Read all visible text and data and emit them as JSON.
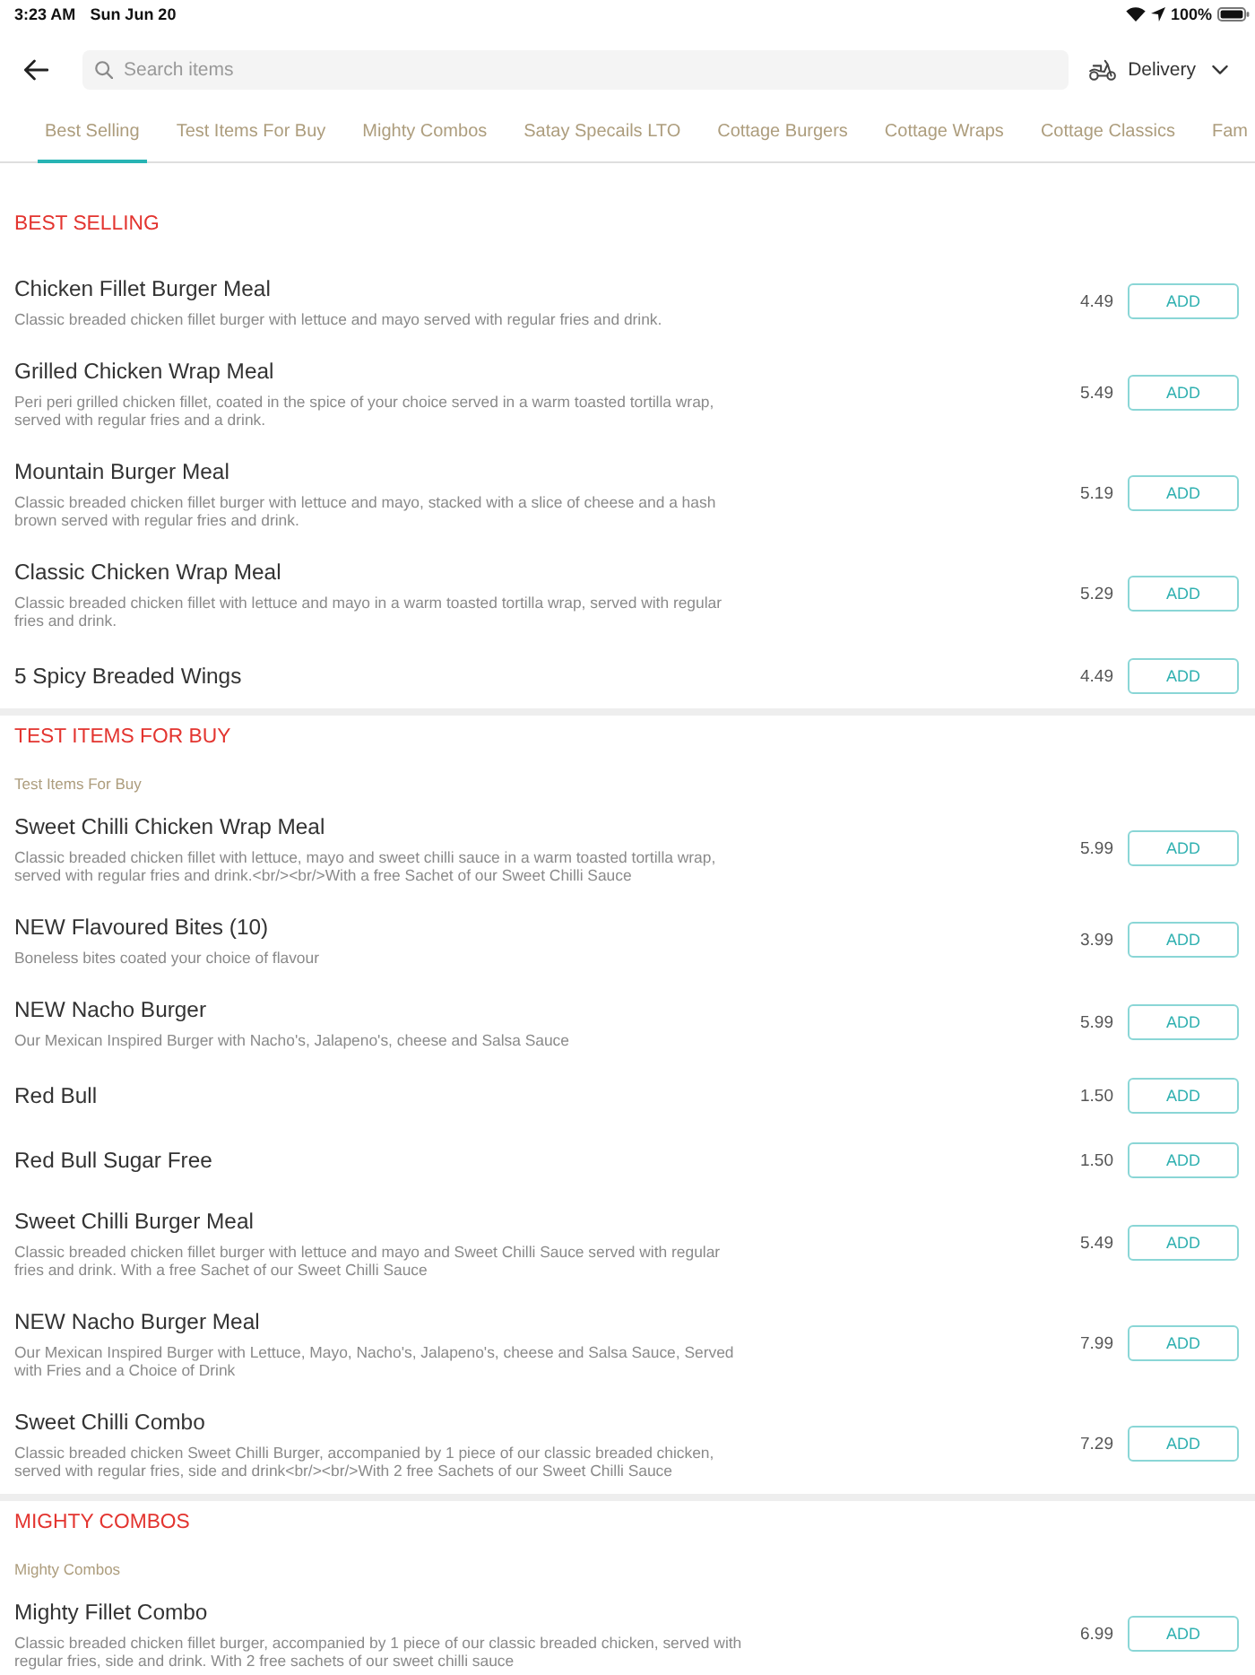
{
  "status_bar": {
    "time": "3:23 AM",
    "date": "Sun Jun 20",
    "battery": "100%"
  },
  "header": {
    "search": {
      "placeholder": "Search items"
    },
    "order_mode": {
      "label": "Delivery"
    }
  },
  "tabs": [
    {
      "label": "Best Selling",
      "selected": true
    },
    {
      "label": "Test Items For Buy",
      "selected": false
    },
    {
      "label": "Mighty Combos",
      "selected": false
    },
    {
      "label": "Satay Specails LTO",
      "selected": false
    },
    {
      "label": "Cottage Burgers",
      "selected": false
    },
    {
      "label": "Cottage Wraps",
      "selected": false
    },
    {
      "label": "Cottage Classics",
      "selected": false
    },
    {
      "label": "Fam",
      "selected": false
    }
  ],
  "sections": [
    {
      "title": "BEST SELLING",
      "items": [
        {
          "name": "Chicken Fillet Burger Meal",
          "description": "Classic breaded chicken fillet burger with lettuce and mayo served with regular fries and drink.",
          "price": "4.49",
          "button": "ADD"
        },
        {
          "name": "Grilled Chicken Wrap Meal",
          "description": "Peri peri grilled chicken fillet, coated in the spice of your choice served in a warm toasted tortilla wrap, served with regular fries and a drink.",
          "price": "5.49",
          "button": "ADD"
        },
        {
          "name": "Mountain Burger Meal",
          "description": "Classic breaded chicken fillet burger with lettuce and mayo, stacked with a slice of cheese and a hash brown served with regular fries and drink.",
          "price": "5.19",
          "button": "ADD"
        },
        {
          "name": "Classic Chicken Wrap Meal",
          "description": "Classic breaded chicken fillet with lettuce and mayo in a warm toasted tortilla wrap, served with regular fries and drink.",
          "price": "5.29",
          "button": "ADD"
        },
        {
          "name": "5 Spicy Breaded Wings",
          "price": "4.49",
          "button": "ADD"
        }
      ]
    },
    {
      "title": "TEST ITEMS FOR BUY",
      "subtitle": "Test Items For Buy",
      "items": [
        {
          "name": "Sweet Chilli Chicken Wrap Meal",
          "description": "Classic breaded chicken fillet with lettuce, mayo and sweet chilli sauce in a warm toasted tortilla wrap, served with regular fries and drink.<br/><br/>With a free Sachet of our Sweet Chilli Sauce",
          "price": "5.99",
          "button": "ADD"
        },
        {
          "name": "NEW Flavoured Bites (10)",
          "description": "Boneless bites coated your choice of flavour",
          "price": "3.99",
          "button": "ADD"
        },
        {
          "name": "NEW Nacho Burger",
          "description": "Our Mexican Inspired Burger with Nacho's, Jalapeno's, cheese and Salsa Sauce",
          "price": "5.99",
          "button": "ADD"
        },
        {
          "name": "Red Bull",
          "price": "1.50",
          "button": "ADD"
        },
        {
          "name": "Red Bull Sugar Free",
          "price": "1.50",
          "button": "ADD"
        },
        {
          "name": "Sweet Chilli Burger Meal",
          "description": "Classic breaded chicken fillet burger with lettuce and mayo and Sweet Chilli Sauce served with regular fries and drink. With a free Sachet of our Sweet Chilli Sauce",
          "price": "5.49",
          "button": "ADD"
        },
        {
          "name": "NEW Nacho Burger Meal",
          "description": "Our Mexican Inspired Burger with Lettuce, Mayo, Nacho's, Jalapeno's, cheese and Salsa Sauce, Served with Fries and a Choice of Drink",
          "price": "7.99",
          "button": "ADD"
        },
        {
          "name": "Sweet Chilli Combo",
          "description": "Classic breaded chicken Sweet Chilli Burger, accompanied by 1 piece of our classic breaded chicken, served with regular fries, side and drink<br/><br/>With 2 free Sachets of our Sweet Chilli Sauce",
          "price": "7.29",
          "button": "ADD"
        }
      ]
    },
    {
      "title": "MIGHTY COMBOS",
      "subtitle": "Mighty Combos",
      "items": [
        {
          "name": "Mighty Fillet Combo",
          "description": "Classic breaded chicken fillet burger, accompanied by 1 piece of our classic breaded chicken, served with regular fries, side and drink. With 2 free sachets of our sweet chilli sauce",
          "price": "6.99",
          "button": "ADD"
        }
      ]
    }
  ]
}
